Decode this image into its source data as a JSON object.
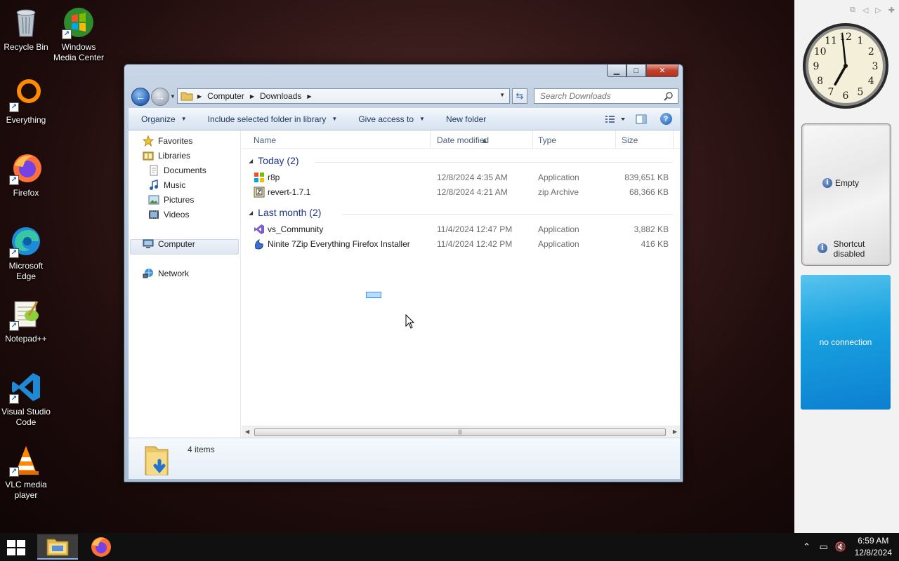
{
  "desktop": {
    "icons": [
      {
        "label": "Recycle Bin",
        "icon": "recycle-bin-icon"
      },
      {
        "label": "Windows Media Center",
        "icon": "media-center-icon"
      },
      {
        "label": "Everything",
        "icon": "everything-icon"
      },
      {
        "label": "Firefox",
        "icon": "firefox-icon"
      },
      {
        "label": "Microsoft Edge",
        "icon": "edge-icon"
      },
      {
        "label": "Notepad++",
        "icon": "notepad-plus-plus-icon"
      },
      {
        "label": "Visual Studio Code",
        "icon": "vscode-icon"
      },
      {
        "label": "VLC media player",
        "icon": "vlc-icon"
      }
    ]
  },
  "explorer": {
    "controls": {
      "minimize": "▁",
      "maximize": "□",
      "close": "✕"
    },
    "breadcrumb": [
      "Computer",
      "Downloads"
    ],
    "search_placeholder": "Search Downloads",
    "toolbar": {
      "organize": "Organize",
      "include": "Include selected folder in library",
      "share": "Give access to",
      "new_folder": "New folder"
    },
    "nav": {
      "favorites": "Favorites",
      "libraries": "Libraries",
      "documents": "Documents",
      "music": "Music",
      "pictures": "Pictures",
      "videos": "Videos",
      "computer": "Computer",
      "network": "Network"
    },
    "columns": {
      "name": "Name",
      "date": "Date modified",
      "type": "Type",
      "size": "Size"
    },
    "groups": [
      {
        "label": "Today (2)",
        "files": [
          {
            "name": "r8p",
            "date": "12/8/2024 4:35 AM",
            "type": "Application",
            "size": "839,651 KB",
            "icon": "installer-icon"
          },
          {
            "name": "revert-1.7.1",
            "date": "12/8/2024 4:21 AM",
            "type": "zip Archive",
            "size": "68,366 KB",
            "icon": "zip-archive-icon"
          }
        ]
      },
      {
        "label": "Last month (2)",
        "files": [
          {
            "name": "vs_Community",
            "date": "11/4/2024 12:47 PM",
            "type": "Application",
            "size": "3,882 KB",
            "icon": "visual-studio-icon"
          },
          {
            "name": "Ninite 7Zip Everything Firefox Installer",
            "date": "11/4/2024 12:42 PM",
            "type": "Application",
            "size": "416 KB",
            "icon": "ninite-icon"
          }
        ]
      }
    ],
    "status": "4 items"
  },
  "gadgets": {
    "clock": {
      "hour": 6,
      "minute": 59,
      "numbers": [
        "12",
        "1",
        "2",
        "3",
        "4",
        "5",
        "6",
        "7",
        "8",
        "9",
        "10",
        "11"
      ]
    },
    "note": {
      "line1": "Empty",
      "line2": "Shortcut disabled"
    },
    "weather": {
      "text": "no connection"
    }
  },
  "taskbar": {
    "time": "6:59 AM",
    "date": "12/8/2024",
    "apps": [
      "file-explorer-icon",
      "firefox-icon"
    ]
  }
}
